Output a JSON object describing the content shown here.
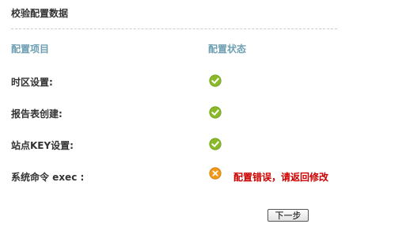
{
  "page": {
    "title": "校验配置数据"
  },
  "table": {
    "headers": {
      "item": "配置项目",
      "status": "配置状态"
    },
    "rows": [
      {
        "label": "时区设置:",
        "status": "ok",
        "icon": "check-circle-icon",
        "message": ""
      },
      {
        "label": "报告表创建:",
        "status": "ok",
        "icon": "check-circle-icon",
        "message": ""
      },
      {
        "label": "站点KEY设置:",
        "status": "ok",
        "icon": "check-circle-icon",
        "message": ""
      },
      {
        "label": "系统命令 exec :",
        "status": "error",
        "icon": "error-circle-icon",
        "message": "配置错误，请返回修改"
      }
    ]
  },
  "actions": {
    "next_label": "下一步"
  },
  "colors": {
    "header_text": "#6d9fb3",
    "ok_icon": "#8ab929",
    "error_icon": "#f09a1a",
    "error_text": "#cc0000",
    "divider": "#cccccc"
  }
}
